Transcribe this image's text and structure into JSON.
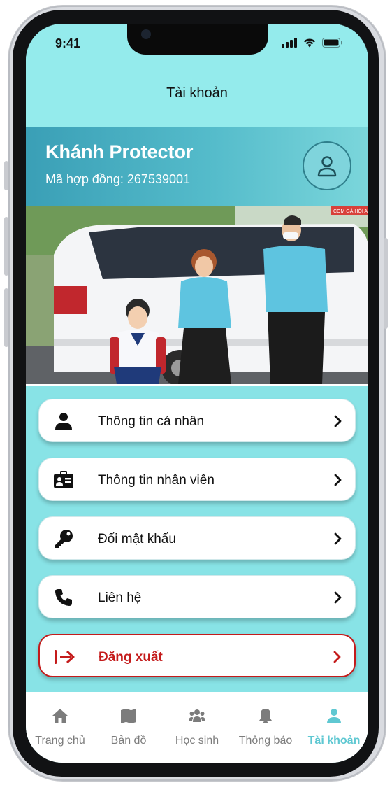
{
  "status_bar": {
    "time": "9:41"
  },
  "header": {
    "title": "Tài khoản"
  },
  "profile": {
    "name": "Khánh Protector",
    "contract_label": "Mã hợp đồng:",
    "contract_number": "267539001"
  },
  "hero": {
    "sign_text": "COM GÀ HỘI AN"
  },
  "menu": {
    "personal_info": "Thông tin cá nhân",
    "staff_info": "Thông tin nhân viên",
    "change_password": "Đổi mật khẩu",
    "contact": "Liên hệ",
    "logout": "Đăng xuất"
  },
  "tabs": {
    "home": "Trang chủ",
    "map": "Bản đồ",
    "students": "Học sinh",
    "notifications": "Thông báo",
    "account": "Tài khoản"
  },
  "colors": {
    "screen_bg": "#88e3e6",
    "header_bg": "#94ebec",
    "banner_gradient_start": "#3a9fb6",
    "logout_red": "#c41b1b",
    "tab_active": "#5fc8d2",
    "tab_inactive": "#7c7c7c"
  }
}
